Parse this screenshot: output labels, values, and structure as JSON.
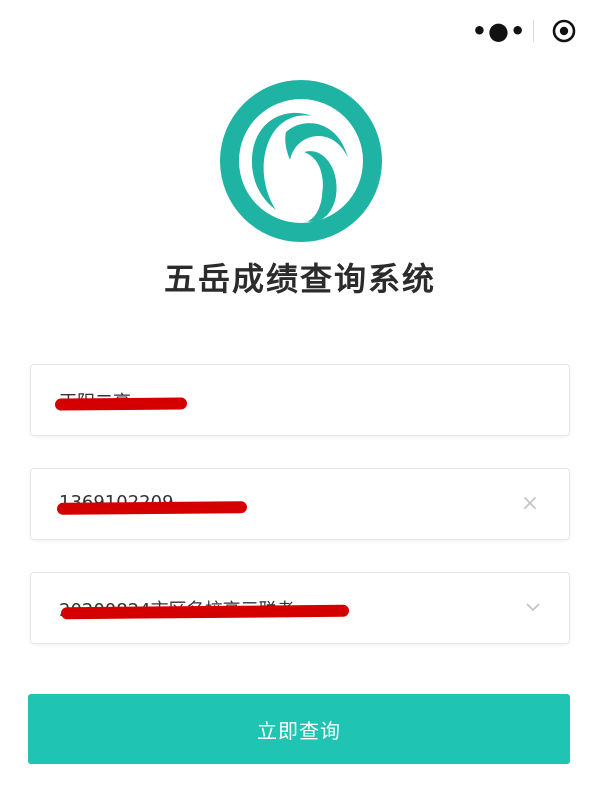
{
  "top_bar": {
    "more_label": "•●•",
    "close_icon": "target-icon"
  },
  "logo": {
    "icon": "app-logo",
    "color": "#1fb3a3"
  },
  "title": "五岳成绩查询系统",
  "form": {
    "school_value": "正阳二高",
    "phone_value": "1369102209",
    "exam_value": "20200824市区名校高三联考",
    "clear_icon": "×",
    "dropdown_icon": "chevron-down-icon"
  },
  "submit_label": "立即查询",
  "colors": {
    "accent": "#1fc4b3",
    "redaction": "#d40000"
  }
}
